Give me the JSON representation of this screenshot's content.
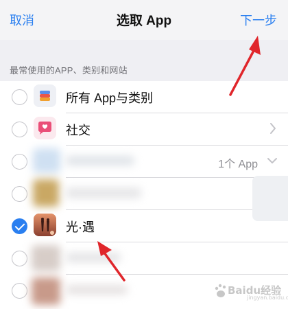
{
  "navbar": {
    "cancel_label": "取消",
    "title": "选取 App",
    "next_label": "下一步",
    "accent_color": "#2a7ff0"
  },
  "section": {
    "header": "最常使用的APP、类别和网站"
  },
  "rows": [
    {
      "label": "所有 App与类别",
      "icon": "layers-stack-icon",
      "checked": false
    },
    {
      "label": "社交",
      "icon": "chat-bubble-heart-icon",
      "checked": false,
      "accessory": "chevron-right"
    },
    {
      "label": "",
      "detail": "1个 App",
      "icon": "blurred-app-icon",
      "checked": false,
      "accessory": "chevron-down"
    },
    {
      "label": "",
      "icon": "blurred-app-icon",
      "checked": false
    },
    {
      "label": "光·遇",
      "icon": "sky-game-icon",
      "checked": true
    },
    {
      "label": "",
      "icon": "blurred-app-icon",
      "checked": false
    },
    {
      "label": "",
      "icon": "blurred-app-icon",
      "checked": false
    }
  ],
  "watermark": {
    "text": "Baidu经验",
    "sub": "jingyan.baidu.com"
  }
}
